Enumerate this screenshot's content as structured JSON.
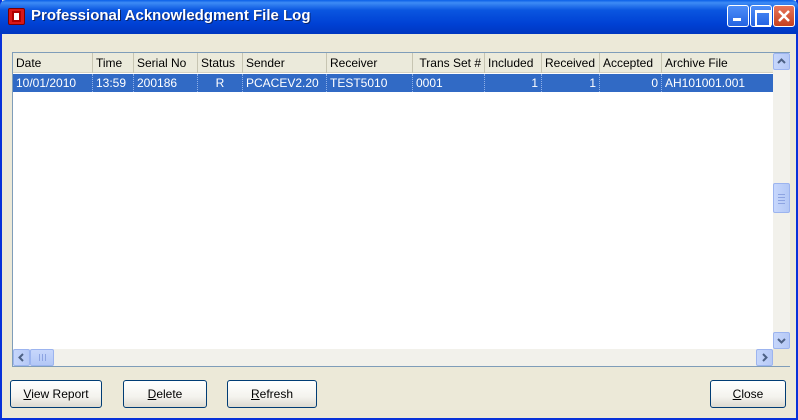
{
  "window": {
    "title": "Professional Acknowledgment File Log"
  },
  "table": {
    "columns": [
      "Date",
      "Time",
      "Serial No",
      "Status",
      "Sender",
      "Receiver",
      "Trans Set #",
      "Included",
      "Received",
      "Accepted",
      "Archive File"
    ],
    "rows": [
      {
        "date": "10/01/2010",
        "time": "13:59",
        "serial_no": "200186",
        "status": "R",
        "sender": "PCACEV2.20",
        "receiver": "TEST5010",
        "trans_set": "0001",
        "included": "1",
        "received": "1",
        "accepted": "0",
        "archive_file": "AH101001.001"
      }
    ]
  },
  "buttons": {
    "view_report": {
      "mnemonic": "V",
      "rest": "iew Report"
    },
    "delete": {
      "mnemonic": "D",
      "rest": "elete"
    },
    "refresh": {
      "mnemonic": "R",
      "rest": "efresh"
    },
    "close": {
      "mnemonic": "C",
      "rest": "lose"
    }
  },
  "colors": {
    "selection": "#316ac5",
    "titlebar": "#0041d4",
    "face": "#ece9d8"
  }
}
